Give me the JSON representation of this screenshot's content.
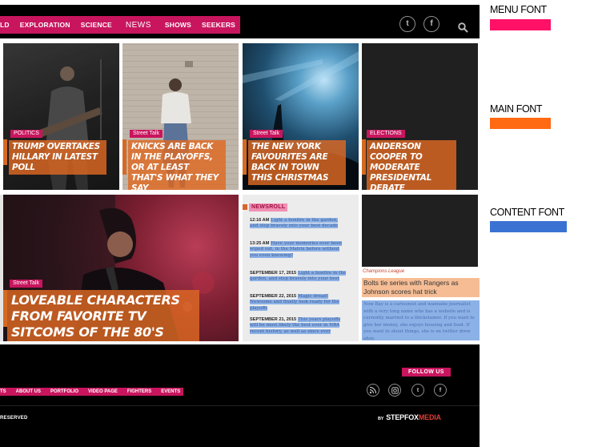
{
  "nav": {
    "items": [
      "LD",
      "EXPLORATION",
      "SCIENCE",
      "NEWS",
      "SHOWS",
      "SEEKERS"
    ],
    "active": "NEWS"
  },
  "panels": [
    {
      "tag": "POLITICS",
      "headline": "TRUMP OVERTAKES HILLARY IN LATEST POLL"
    },
    {
      "tag": "Street Talk",
      "headline": "KNICKS ARE BACK IN THE PLAYOFFS, OR AT LEAST THAT'S WHAT THEY SAY"
    },
    {
      "tag": "Street Talk",
      "headline": "THE NEW YORK FAVOURITES ARE BACK IN TOWN THIS CHRISTMAS"
    },
    {
      "tag": "ELECTIONS",
      "headline": "ANDERSON COOPER TO MODERATE PRESIDENTAL DEBATE"
    }
  ],
  "feature": {
    "tag": "Street Talk",
    "headline": "LOVEABLE CHARACTERS FROM FAVORITE TV SITCOMS OF THE 80's"
  },
  "newsroll": {
    "title": "NEWSROLL",
    "items": [
      {
        "time": "12:16 AM",
        "text": "Light a bonfire in the garden, and step bravely into your best decade"
      },
      {
        "time": "13:25 AM",
        "text": "Have your memories ever been wiped out, in the Matrix before without you even knowing?"
      },
      {
        "time": "SEPTEMBER 17, 2015",
        "text": "Light a bonfire in the garden, and step bravely into your best"
      },
      {
        "time": "SEPTEMBER 22, 2015",
        "text": "Magic dread! Newsome and finally look ready for the playoffs"
      },
      {
        "time": "SEPTEMBER 21, 2015",
        "text": "This years playoffs will be most likely the best ever in NBA recent history, as well as since ever"
      }
    ]
  },
  "champions": {
    "label": "Champions League",
    "title": "Bolts tie series with Rangers as Johnson scores hat trick",
    "body": "Now Bay is a cartoonist and wannabe journalist with a very long name who has a website and is currently married to a thickstamer. If you want to give her money, she enjoys housing and food. If you want to shout things, she is on twitter drew ahoy."
  },
  "footer": {
    "follow": "FOLLOW US",
    "menu": [
      "TS",
      "ABOUT US",
      "PORTFOLIO",
      "VIDEO PAGE",
      "FIGHTERS",
      "EVENTS"
    ],
    "reserved": "RESERVED",
    "brand_by": "BY",
    "brand_a": "STEPFOX",
    "brand_b": "MEDIA"
  },
  "legend": [
    {
      "label": "MENU FONT",
      "color": "#ff1167"
    },
    {
      "label": "MAIN FONT",
      "color": "#ff6a13"
    },
    {
      "label": "CONTENT FONT",
      "color": "#3a72d4"
    }
  ],
  "colors": {
    "menu_bar": "#c8155e",
    "headline_bg": "#de6923",
    "content_highlight": "#8bb1e6"
  },
  "icons": [
    "twitter-icon",
    "facebook-icon",
    "search-icon",
    "rss-icon",
    "instagram-icon"
  ]
}
